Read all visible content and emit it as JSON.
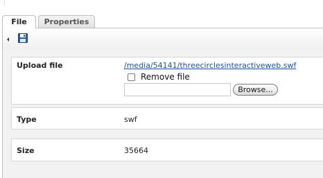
{
  "tabs": [
    {
      "label": "File"
    },
    {
      "label": "Properties"
    }
  ],
  "toolbar": {
    "back_icon": "chevron-left-icon",
    "save_icon": "floppy-disk-icon"
  },
  "fields": {
    "upload": {
      "label": "Upload file",
      "file_link": "/media/54141/threecirclesinteractiveweb.swf",
      "remove_label": "Remove file",
      "file_input_value": "",
      "browse_label": "Browse..."
    },
    "type": {
      "label": "Type",
      "value": "swf"
    },
    "size": {
      "label": "Size",
      "value": "35664"
    }
  },
  "colors": {
    "link": "#1a4e9e",
    "panel_bg": "#f2f2f2",
    "border": "#bcbcbc"
  }
}
